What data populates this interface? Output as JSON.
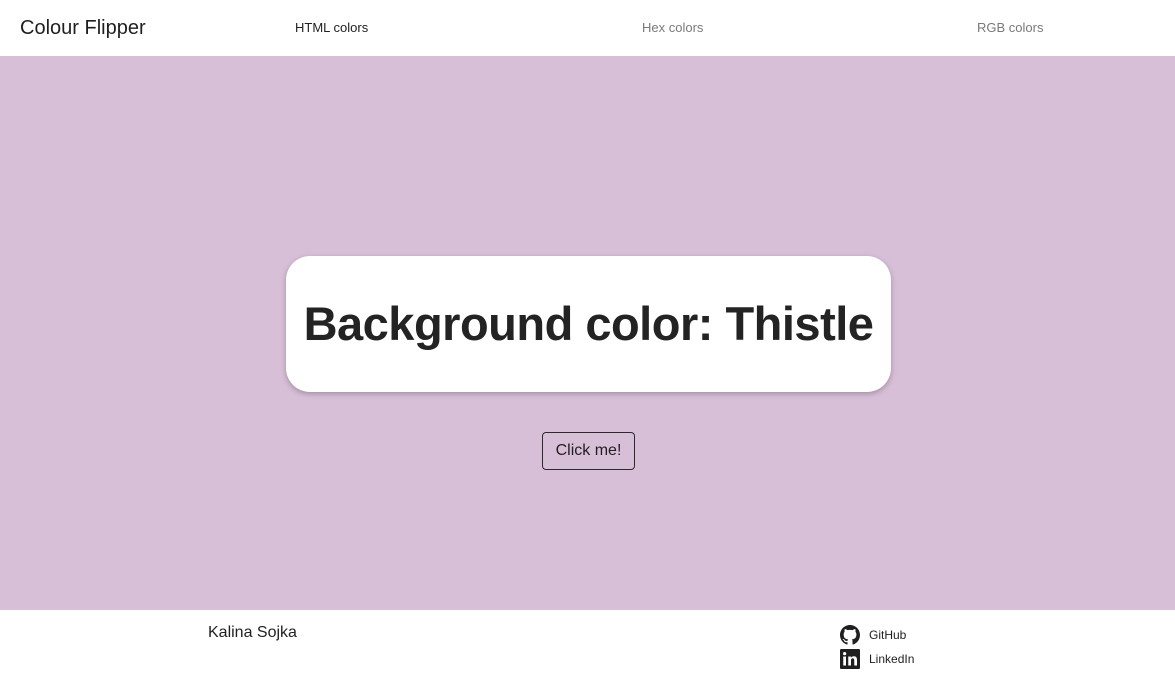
{
  "navbar": {
    "brand": "Colour Flipper",
    "links": [
      {
        "label": "HTML colors",
        "active": true
      },
      {
        "label": "Hex colors",
        "active": false
      },
      {
        "label": "RGB colors",
        "active": false
      }
    ]
  },
  "main": {
    "background_color": "#D8BFD8",
    "heading": "Background color: Thistle",
    "button_label": "Click me!"
  },
  "footer": {
    "author": "Kalina Sojka",
    "links": [
      {
        "label": "GitHub",
        "icon": "github-icon"
      },
      {
        "label": "LinkedIn",
        "icon": "linkedin-icon"
      }
    ]
  }
}
